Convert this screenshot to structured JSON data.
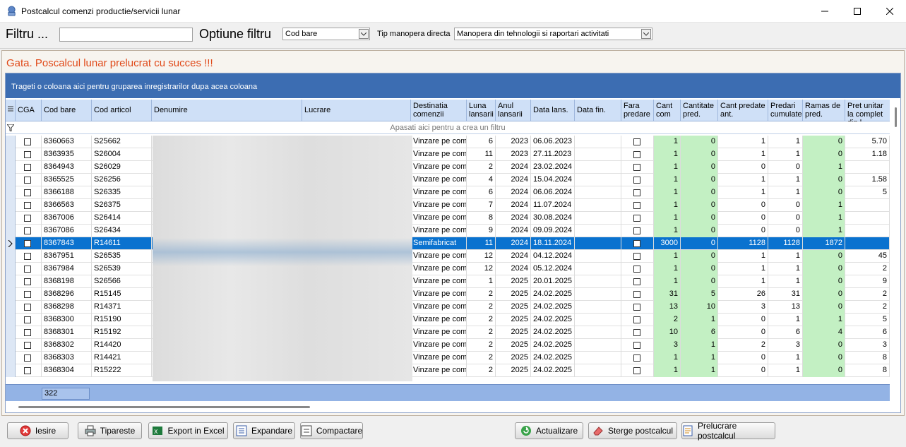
{
  "window": {
    "title": "Postcalcul comenzi productie/servicii lunar"
  },
  "filter": {
    "label": "Filtru ...",
    "value": "",
    "option_label": "Optiune filtru",
    "option_value": "Cod bare",
    "tip_label": "Tip manopera directa",
    "tip_value": "Manopera din tehnologii si raportari activitati"
  },
  "status_message": "Gata. Poscalcul lunar prelucrat cu succes !!!",
  "grid": {
    "group_panel_text": "Trageti o coloana aici pentru gruparea inregistrarilor dupa acea coloana",
    "filter_row_text": "Apasati aici pentru a crea un filtru",
    "columns": [
      "CGA",
      "Cod bare",
      "Cod articol",
      "Denumire",
      "Lucrare",
      "Destinatia comenzii",
      "Luna lansarii",
      "Anul lansarii",
      "Data lans.",
      "Data fin.",
      "Fara predare",
      "Cant com",
      "Cantitate pred.",
      "Cant predate ant.",
      "Predari cumulate",
      "Ramas de pred.",
      "Pret unitar la complet din l"
    ],
    "rows": [
      {
        "cod_bare": "8360663",
        "cod_articol": "S25662",
        "destinatia": "Vinzare pe come",
        "luna": "6",
        "anul": "2023",
        "data_lans": "06.06.2023",
        "cant_com": "1",
        "cant_pred": "0",
        "cant_ant": "1",
        "cumulate": "1",
        "ramas": "0",
        "pret": "5.70"
      },
      {
        "cod_bare": "8363935",
        "cod_articol": "S26004",
        "destinatia": "Vinzare pe come",
        "luna": "11",
        "anul": "2023",
        "data_lans": "27.11.2023",
        "cant_com": "1",
        "cant_pred": "0",
        "cant_ant": "1",
        "cumulate": "1",
        "ramas": "0",
        "pret": "1.18"
      },
      {
        "cod_bare": "8364943",
        "cod_articol": "S26029",
        "destinatia": "Vinzare pe come",
        "luna": "2",
        "anul": "2024",
        "data_lans": "23.02.2024",
        "cant_com": "1",
        "cant_pred": "0",
        "cant_ant": "0",
        "cumulate": "0",
        "ramas": "1",
        "pret": ""
      },
      {
        "cod_bare": "8365525",
        "cod_articol": "S26256",
        "destinatia": "Vinzare pe come",
        "luna": "4",
        "anul": "2024",
        "data_lans": "15.04.2024",
        "cant_com": "1",
        "cant_pred": "0",
        "cant_ant": "1",
        "cumulate": "1",
        "ramas": "0",
        "pret": "1.58"
      },
      {
        "cod_bare": "8366188",
        "cod_articol": "S26335",
        "destinatia": "Vinzare pe come",
        "luna": "6",
        "anul": "2024",
        "data_lans": "06.06.2024",
        "cant_com": "1",
        "cant_pred": "0",
        "cant_ant": "1",
        "cumulate": "1",
        "ramas": "0",
        "pret": "5"
      },
      {
        "cod_bare": "8366563",
        "cod_articol": "S26375",
        "destinatia": "Vinzare pe come",
        "luna": "7",
        "anul": "2024",
        "data_lans": "11.07.2024",
        "cant_com": "1",
        "cant_pred": "0",
        "cant_ant": "0",
        "cumulate": "0",
        "ramas": "1",
        "pret": ""
      },
      {
        "cod_bare": "8367006",
        "cod_articol": "S26414",
        "destinatia": "Vinzare pe come",
        "luna": "8",
        "anul": "2024",
        "data_lans": "30.08.2024",
        "cant_com": "1",
        "cant_pred": "0",
        "cant_ant": "0",
        "cumulate": "0",
        "ramas": "1",
        "pret": ""
      },
      {
        "cod_bare": "8367086",
        "cod_articol": "S26434",
        "destinatia": "Vinzare pe come",
        "luna": "9",
        "anul": "2024",
        "data_lans": "09.09.2024",
        "cant_com": "1",
        "cant_pred": "0",
        "cant_ant": "0",
        "cumulate": "0",
        "ramas": "1",
        "pret": ""
      },
      {
        "cod_bare": "8367843",
        "cod_articol": "R14611",
        "destinatia": "Semifabricat",
        "luna": "11",
        "anul": "2024",
        "data_lans": "18.11.2024",
        "cant_com": "3000",
        "cant_pred": "0",
        "cant_ant": "1128",
        "cumulate": "1128",
        "ramas": "1872",
        "pret": ""
      },
      {
        "cod_bare": "8367951",
        "cod_articol": "S26535",
        "destinatia": "Vinzare pe come",
        "luna": "12",
        "anul": "2024",
        "data_lans": "04.12.2024",
        "cant_com": "1",
        "cant_pred": "0",
        "cant_ant": "1",
        "cumulate": "1",
        "ramas": "0",
        "pret": "45"
      },
      {
        "cod_bare": "8367984",
        "cod_articol": "S26539",
        "destinatia": "Vinzare pe come",
        "luna": "12",
        "anul": "2024",
        "data_lans": "05.12.2024",
        "cant_com": "1",
        "cant_pred": "0",
        "cant_ant": "1",
        "cumulate": "1",
        "ramas": "0",
        "pret": "2"
      },
      {
        "cod_bare": "8368198",
        "cod_articol": "S26566",
        "destinatia": "Vinzare pe come",
        "luna": "1",
        "anul": "2025",
        "data_lans": "20.01.2025",
        "cant_com": "1",
        "cant_pred": "0",
        "cant_ant": "1",
        "cumulate": "1",
        "ramas": "0",
        "pret": "9"
      },
      {
        "cod_bare": "8368296",
        "cod_articol": "R15145",
        "destinatia": "Vinzare pe come",
        "luna": "2",
        "anul": "2025",
        "data_lans": "24.02.2025",
        "cant_com": "31",
        "cant_pred": "5",
        "cant_ant": "26",
        "cumulate": "31",
        "ramas": "0",
        "pret": "2"
      },
      {
        "cod_bare": "8368298",
        "cod_articol": "R14371",
        "destinatia": "Vinzare pe come",
        "luna": "2",
        "anul": "2025",
        "data_lans": "24.02.2025",
        "cant_com": "13",
        "cant_pred": "10",
        "cant_ant": "3",
        "cumulate": "13",
        "ramas": "0",
        "pret": "2"
      },
      {
        "cod_bare": "8368300",
        "cod_articol": "R15190",
        "destinatia": "Vinzare pe come",
        "luna": "2",
        "anul": "2025",
        "data_lans": "24.02.2025",
        "cant_com": "2",
        "cant_pred": "1",
        "cant_ant": "0",
        "cumulate": "1",
        "ramas": "1",
        "pret": "5"
      },
      {
        "cod_bare": "8368301",
        "cod_articol": "R15192",
        "destinatia": "Vinzare pe come",
        "luna": "2",
        "anul": "2025",
        "data_lans": "24.02.2025",
        "cant_com": "10",
        "cant_pred": "6",
        "cant_ant": "0",
        "cumulate": "6",
        "ramas": "4",
        "pret": "6"
      },
      {
        "cod_bare": "8368302",
        "cod_articol": "R14420",
        "destinatia": "Vinzare pe come",
        "luna": "2",
        "anul": "2025",
        "data_lans": "24.02.2025",
        "cant_com": "3",
        "cant_pred": "1",
        "cant_ant": "2",
        "cumulate": "3",
        "ramas": "0",
        "pret": "3"
      },
      {
        "cod_bare": "8368303",
        "cod_articol": "R14421",
        "destinatia": "Vinzare pe come",
        "luna": "2",
        "anul": "2025",
        "data_lans": "24.02.2025",
        "cant_com": "1",
        "cant_pred": "1",
        "cant_ant": "0",
        "cumulate": "1",
        "ramas": "0",
        "pret": "8"
      },
      {
        "cod_bare": "8368304",
        "cod_articol": "R15222",
        "destinatia": "Vinzare pe come",
        "luna": "2",
        "anul": "2025",
        "data_lans": "24.02.2025",
        "cant_com": "1",
        "cant_pred": "1",
        "cant_ant": "0",
        "cumulate": "1",
        "ramas": "0",
        "pret": "8"
      }
    ],
    "selected_row": 8,
    "footer_count": "322"
  },
  "buttons": {
    "iesire": "Iesire",
    "tipareste": "Tipareste",
    "export": "Export in Excel",
    "expandare": "Expandare",
    "compactare": "Compactare",
    "actualizare": "Actualizare",
    "sterge": "Sterge postcalcul",
    "prelucrare": "Prelucrare postcalcul"
  },
  "colors": {
    "status": "#e04a1a",
    "group_panel": "#3c6db2",
    "selected_row": "#0a72cf",
    "green_cells": "#c3f0c3",
    "footer": "#93b3e5"
  }
}
